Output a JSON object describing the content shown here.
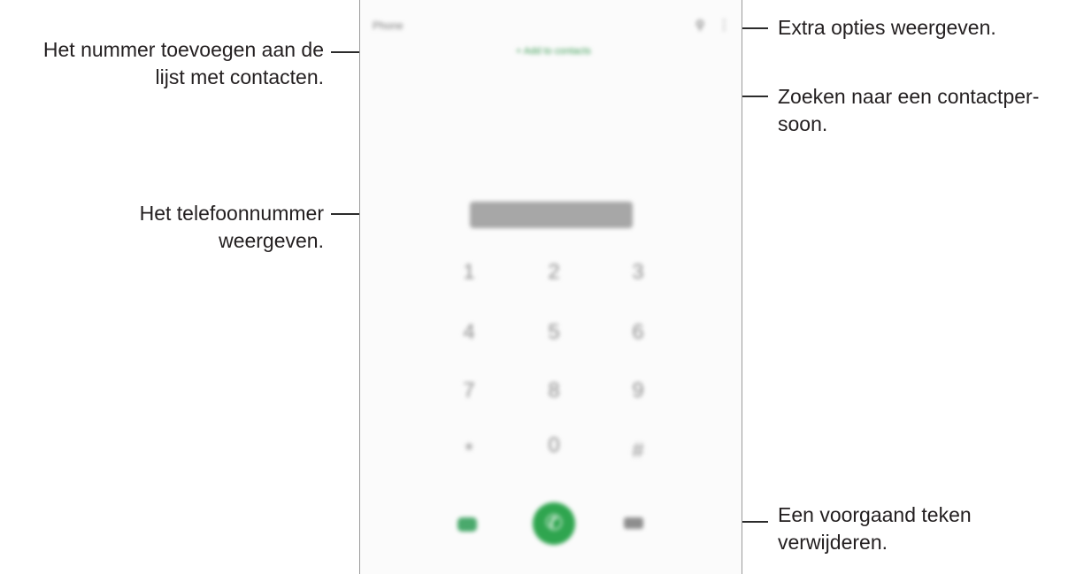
{
  "callouts": {
    "add_contact": [
      "Het nummer toevoegen aan de",
      "lijst met contacten."
    ],
    "more_options": [
      "Extra opties weergeven."
    ],
    "search_contact": [
      "Zoeken naar een contactper-",
      "soon."
    ],
    "phone_number": [
      "Het telefoonnummer",
      "weergeven."
    ],
    "backspace": [
      "Een voorgaand teken",
      "verwijderen."
    ]
  },
  "phone": {
    "app_title": "Phone",
    "add_to_contacts": "+ Add to contacts",
    "search_icon": "search-icon",
    "more_icon": "more-options-icon",
    "number": "0000000000",
    "keys": [
      "1",
      "2",
      "3",
      "4",
      "5",
      "6",
      "7",
      "8",
      "9",
      "*",
      "0",
      "#"
    ],
    "video_call_icon": "video-call-icon",
    "call_icon": "phone-icon",
    "backspace_icon": "backspace-icon",
    "accent_color": "#2fa54f"
  }
}
